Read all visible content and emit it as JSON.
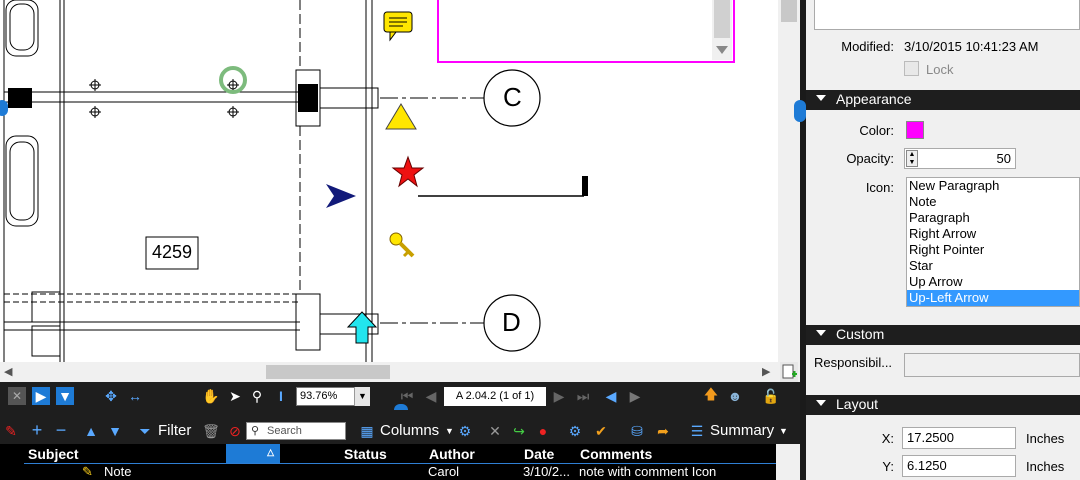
{
  "drawing": {
    "room_label": "4259",
    "grid_labels": [
      "C",
      "D"
    ]
  },
  "navbar": {
    "zoom": "93.76%",
    "page": "A 2.04.2 (1 of 1)"
  },
  "listbar": {
    "filter_label": "Filter",
    "search_placeholder": "Search",
    "columns_label": "Columns",
    "summary_label": "Summary"
  },
  "table": {
    "headers": [
      "Subject",
      "Status",
      "Author",
      "Date",
      "Comments"
    ],
    "rows": [
      {
        "subject": "Note",
        "status": "",
        "author": "Carol",
        "date": "3/10/2...",
        "comments": "note with comment Icon"
      }
    ]
  },
  "properties": {
    "modified_label": "Modified:",
    "modified_value": "3/10/2015 10:41:23 AM",
    "lock_label": "Lock",
    "appearance_title": "Appearance",
    "color_label": "Color:",
    "color_value": "#ff00ff",
    "opacity_label": "Opacity:",
    "opacity_value": "50",
    "icon_label": "Icon:",
    "icon_options": [
      "New Paragraph",
      "Note",
      "Paragraph",
      "Right Arrow",
      "Right Pointer",
      "Star",
      "Up Arrow",
      "Up-Left Arrow"
    ],
    "icon_selected": "Up-Left Arrow",
    "custom_title": "Custom",
    "responsibility_label": "Responsibil...",
    "responsibility_value": "",
    "layout_title": "Layout",
    "x_label": "X:",
    "x_value": "17.2500",
    "x_unit": "Inches",
    "y_label": "Y:",
    "y_value": "6.1250",
    "y_unit": "Inches"
  },
  "colors": {
    "accent": "#1e7bd6",
    "toolbar_bg": "#1e1e1e",
    "selection": "#3399ff",
    "markup_magenta": "#ff00ff"
  }
}
